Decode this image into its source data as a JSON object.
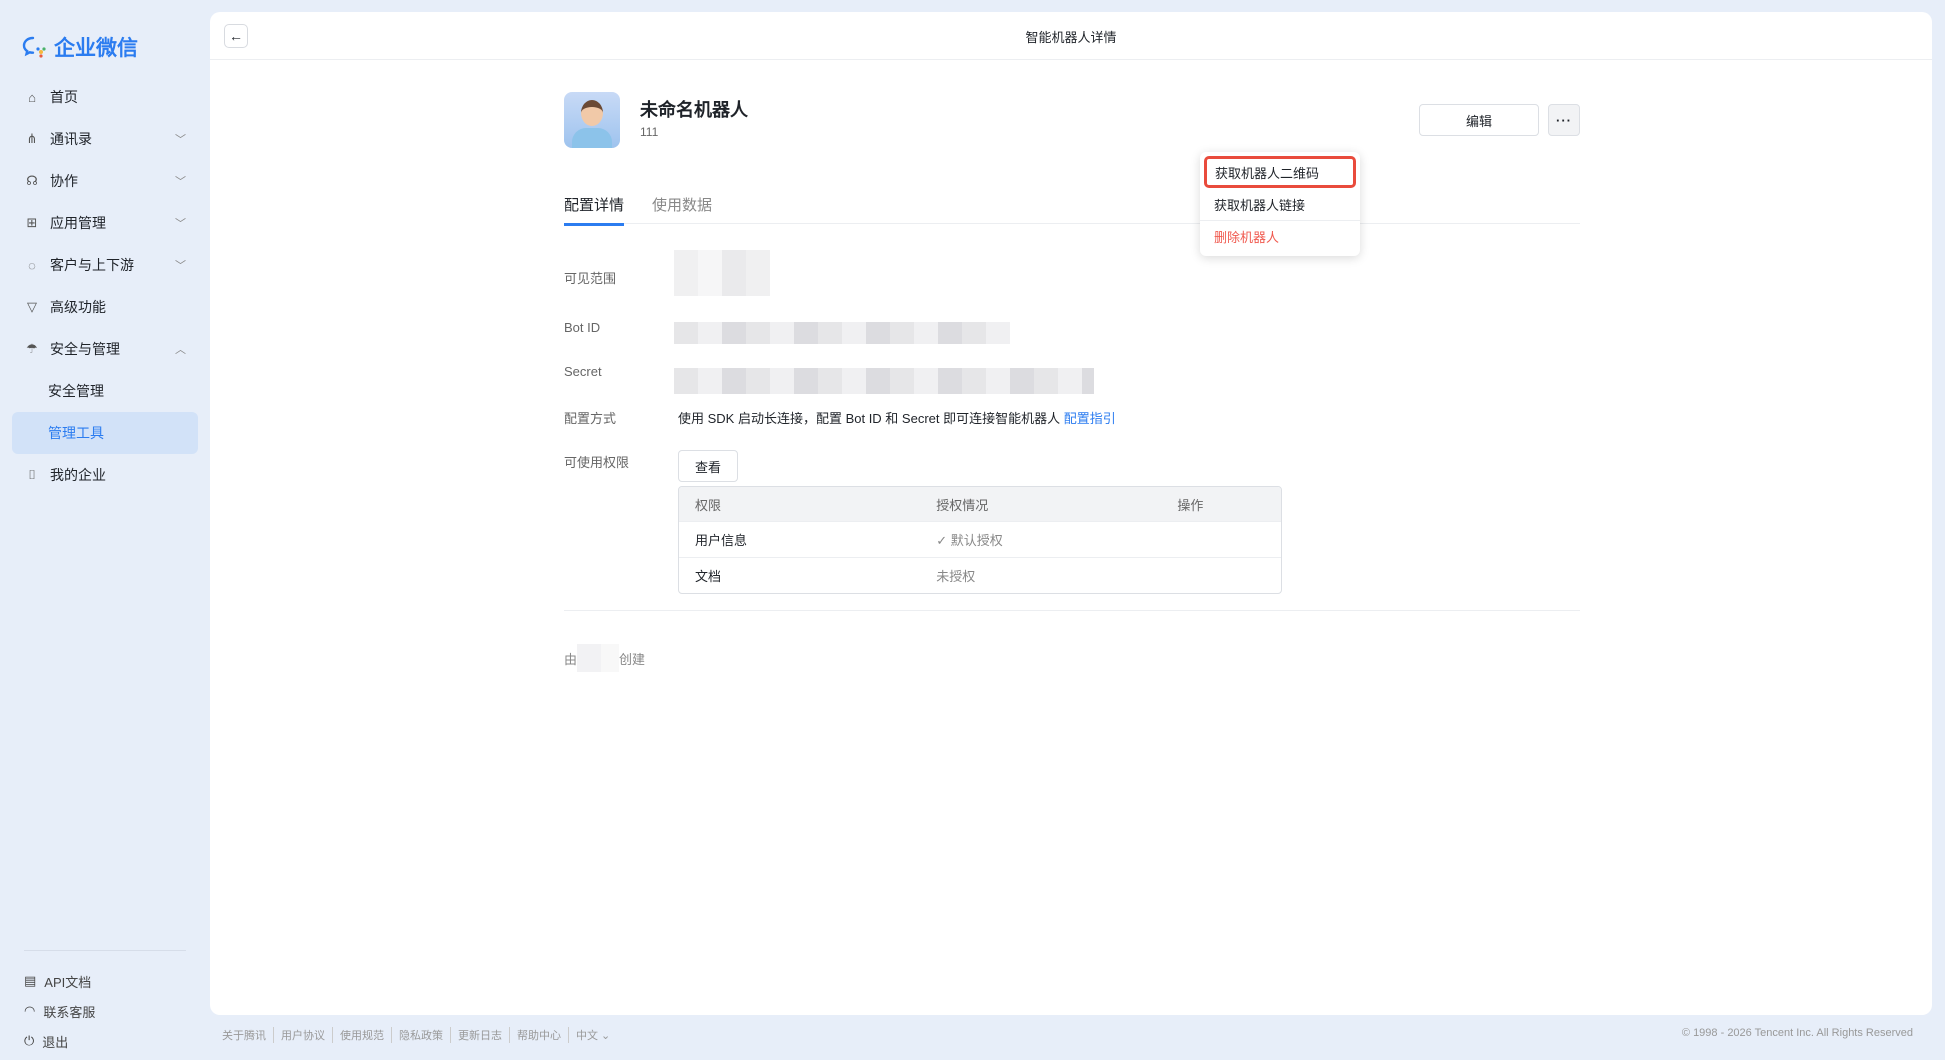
{
  "brand": "企业微信",
  "nav": [
    {
      "label": "首页",
      "icon": "home-icon"
    },
    {
      "label": "通讯录",
      "icon": "contacts-icon",
      "chevron": "down"
    },
    {
      "label": "协作",
      "icon": "collab-icon",
      "chevron": "down"
    },
    {
      "label": "应用管理",
      "icon": "apps-icon",
      "chevron": "down"
    },
    {
      "label": "客户与上下游",
      "icon": "chat-icon",
      "chevron": "down"
    },
    {
      "label": "高级功能",
      "icon": "advanced-icon"
    },
    {
      "label": "安全与管理",
      "icon": "umbrella-icon",
      "chevron": "up"
    },
    {
      "label": "安全管理"
    },
    {
      "label": "管理工具",
      "active": true
    },
    {
      "label": "我的企业",
      "icon": "company-icon"
    }
  ],
  "sidebar_bottom": [
    "API文档",
    "联系客服",
    "退出"
  ],
  "page_title": "智能机器人详情",
  "bot": {
    "name": "未命名机器人",
    "desc": "111"
  },
  "buttons": {
    "edit": "编辑",
    "more": "···",
    "view": "查看"
  },
  "menu": [
    "获取机器人二维码",
    "获取机器人链接",
    "删除机器人"
  ],
  "tabs": [
    "配置详情",
    "使用数据"
  ],
  "fields": {
    "scope": "可见范围",
    "bot_id": "Bot ID",
    "secret": "Secret",
    "config": "配置方式",
    "perm": "可使用权限"
  },
  "config_text": "使用 SDK 启动长连接，配置 Bot ID 和 Secret 即可连接智能机器人 ",
  "config_link": "配置指引",
  "table": {
    "headers": [
      "权限",
      "授权情况",
      "操作"
    ],
    "rows": [
      [
        "用户信息",
        "✓ 默认授权",
        ""
      ],
      [
        "文档",
        "未授权",
        ""
      ]
    ]
  },
  "creator": {
    "prefix": "由",
    "suffix": "创建"
  },
  "footer": [
    "关于腾讯",
    "用户协议",
    "使用规范",
    "隐私政策",
    "更新日志",
    "帮助中心",
    "中文 ⌄"
  ],
  "copyright": "© 1998 - 2026 Tencent Inc. All Rights Reserved",
  "colors": {
    "accent": "#2b7cf0",
    "danger": "#f05a4f",
    "highlight": "#e94b3c"
  }
}
